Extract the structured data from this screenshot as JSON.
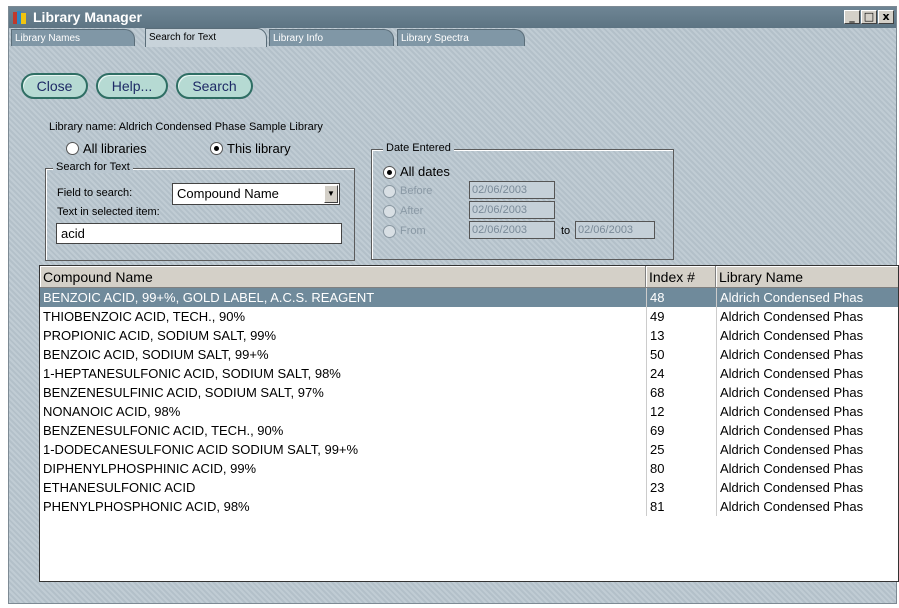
{
  "app": {
    "title": "Library Manager"
  },
  "tabs": [
    "Library Names",
    "Search for Text",
    "Library Info",
    "Library Spectra"
  ],
  "toolbar": {
    "close_label": "Close",
    "help_label": "Help...",
    "search_label": "Search"
  },
  "library_name_text": "Library name: Aldrich Condensed Phase Sample Library",
  "scope": {
    "all_label": "All libraries",
    "this_label": "This library",
    "selected": "This library"
  },
  "search_group": {
    "title": "Search for Text",
    "field_label": "Field to search:",
    "field_value": "Compound Name",
    "text_label": "Text in selected item:",
    "text_value": "acid"
  },
  "date_group": {
    "title": "Date Entered",
    "all_label": "All dates",
    "before_label": "Before",
    "after_label": "After",
    "from_label": "From",
    "to_label": "to",
    "before_date": "02/06/2003",
    "after_date": "02/06/2003",
    "from_date": "02/06/2003",
    "to_date": "02/06/2003"
  },
  "table": {
    "columns": [
      "Compound Name",
      "Index #",
      "Library Name"
    ],
    "rows": [
      [
        "BENZOIC ACID, 99+%, GOLD LABEL, A.C.S. REAGENT",
        "48",
        "Aldrich Condensed Phas"
      ],
      [
        "THIOBENZOIC ACID, TECH., 90%",
        "49",
        "Aldrich Condensed Phas"
      ],
      [
        "PROPIONIC ACID, SODIUM SALT, 99%",
        "13",
        "Aldrich Condensed Phas"
      ],
      [
        "BENZOIC ACID, SODIUM SALT, 99+%",
        "50",
        "Aldrich Condensed Phas"
      ],
      [
        "1-HEPTANESULFONIC ACID, SODIUM SALT, 98%",
        "24",
        "Aldrich Condensed Phas"
      ],
      [
        "BENZENESULFINIC ACID, SODIUM SALT, 97%",
        "68",
        "Aldrich Condensed Phas"
      ],
      [
        "NONANOIC ACID, 98%",
        "12",
        "Aldrich Condensed Phas"
      ],
      [
        "BENZENESULFONIC ACID, TECH., 90%",
        "69",
        "Aldrich Condensed Phas"
      ],
      [
        "1-DODECANESULFONIC ACID SODIUM SALT, 99+%",
        "25",
        "Aldrich Condensed Phas"
      ],
      [
        "DIPHENYLPHOSPHINIC ACID, 99%",
        "80",
        "Aldrich Condensed Phas"
      ],
      [
        "ETHANESULFONIC ACID",
        "23",
        "Aldrich Condensed Phas"
      ],
      [
        "PHENYLPHOSPHONIC ACID, 98%",
        "81",
        "Aldrich Condensed Phas"
      ]
    ],
    "selected_row": 0
  },
  "colors": {
    "titlebar": "#6e8594",
    "selection": "#6f8a9b",
    "button_border": "#2f6e64"
  },
  "icons": {
    "app": "library-books-icon",
    "minimize": "minimize-icon",
    "maximize": "maximize-icon",
    "close": "close-icon",
    "dropdown": "chevron-down-icon"
  }
}
